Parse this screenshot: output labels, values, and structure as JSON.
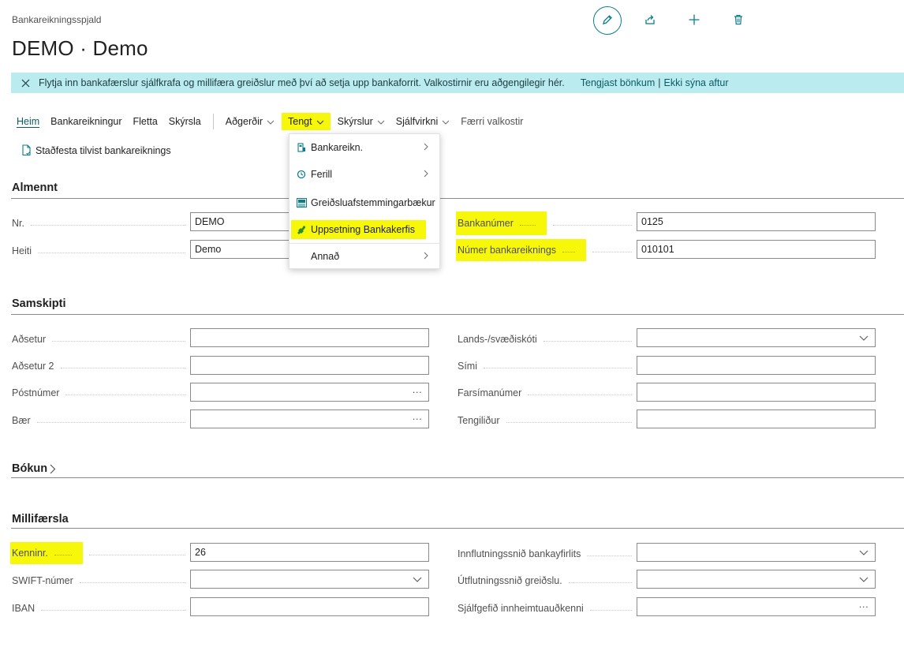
{
  "page": {
    "kicker": "Bankareikningsspjald",
    "title": "DEMO · Demo"
  },
  "banner": {
    "text": "Flytja inn bankafærslur sjálfkrafa og millifæra greiðslur með því að setja upp bankaforrit. Valkostirnir eru aðgengilegir hér.",
    "link_connect": "Tengjast bönkum",
    "separator": "|",
    "link_dismiss": "Ekki sýna aftur"
  },
  "ribbon": {
    "home": "Heim",
    "bank_account": "Bankareikningur",
    "navigate": "Fletta",
    "report": "Skýrsla",
    "actions": "Aðgerðir",
    "related": "Tengt",
    "reports": "Skýrslur",
    "automate": "Sjálfvirkni",
    "fewer_options": "Færri valkostir"
  },
  "subbar": {
    "verify": "Staðfesta tilvist bankareiknings"
  },
  "related_menu": {
    "items": [
      {
        "label": "Bankareikn.",
        "icon": "bank-account-icon"
      },
      {
        "label": "Ferill",
        "icon": "history-icon"
      },
      {
        "label": "Greiðsluafstemmingarbækur",
        "icon": "journal-icon"
      },
      {
        "label": "Uppsetning Bankakerfis",
        "icon": "puzzle-icon"
      },
      {
        "label": "Annað",
        "icon": ""
      }
    ]
  },
  "sections": {
    "general": "Almennt",
    "communication": "Samskipti",
    "posting": "Bókun",
    "transfer": "Millifærsla"
  },
  "general": {
    "no_label": "Nr.",
    "no_value": "DEMO",
    "name_label": "Heiti",
    "name_value": "Demo",
    "bank_branch_label": "Bankanúmer",
    "bank_branch_value": "0125",
    "bank_account_no_label": "Númer bankareiknings",
    "bank_account_no_value": "010101"
  },
  "communication": {
    "address_label": "Aðsetur",
    "address2_label": "Aðsetur 2",
    "post_code_label": "Póstnúmer",
    "city_label": "Bær",
    "country_label": "Lands-/svæðiskóti",
    "phone_label": "Sími",
    "mobile_label": "Farsímanúmer",
    "contact_label": "Tengiliður",
    "address_value": "",
    "address2_value": "",
    "post_code_value": "",
    "city_value": "",
    "country_value": "",
    "phone_value": "",
    "mobile_value": "",
    "contact_value": ""
  },
  "transfer": {
    "id_label": "Kenninr.",
    "id_value": "26",
    "swift_label": "SWIFT-númer",
    "swift_value": "",
    "iban_label": "IBAN",
    "iban_value": "",
    "import_format_label": "Innflutningssnið bankayfirlits",
    "import_format_value": "",
    "export_format_label": "Útflutningssnið greiðslu.",
    "export_format_value": "",
    "default_collection_label": "Sjálfgefið innheimtuauðkenni",
    "default_collection_value": ""
  },
  "colors": {
    "accent": "#0b7d8a",
    "highlight": "#f7f70a",
    "banner_bg": "#baebef"
  }
}
